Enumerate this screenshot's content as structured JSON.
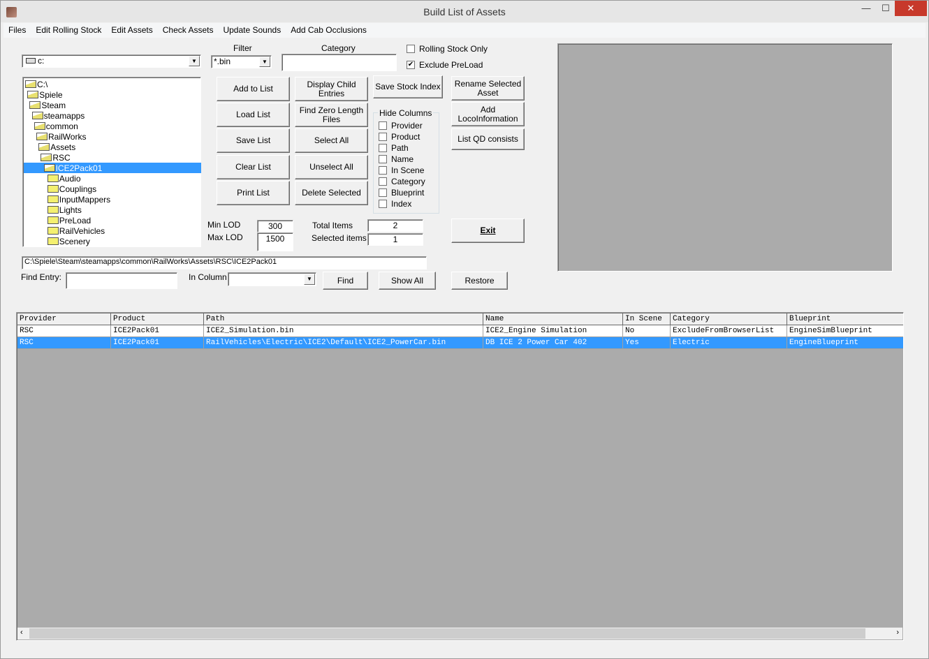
{
  "window": {
    "title": "Build List of Assets",
    "minimize": "—",
    "maximize": "☐",
    "close": "✕"
  },
  "menu": [
    "Files",
    "Edit Rolling Stock",
    "Edit Assets",
    "Check Assets",
    "Update Sounds",
    "Add Cab Occlusions"
  ],
  "drive": {
    "value": "c:"
  },
  "filter": {
    "label": "Filter",
    "value": "*.bin"
  },
  "category": {
    "label": "Category",
    "value": ""
  },
  "options": {
    "rolling_stock_only": {
      "label": "Rolling Stock Only",
      "checked": false
    },
    "exclude_preload": {
      "label": "Exclude PreLoad",
      "checked": true
    }
  },
  "tree": [
    {
      "label": "C:\\",
      "depth": 0,
      "open": true
    },
    {
      "label": "Spiele",
      "depth": 1,
      "open": true
    },
    {
      "label": "Steam",
      "depth": 2,
      "open": true
    },
    {
      "label": "steamapps",
      "depth": 3,
      "open": true
    },
    {
      "label": "common",
      "depth": 4,
      "open": true
    },
    {
      "label": "RailWorks",
      "depth": 5,
      "open": true
    },
    {
      "label": "Assets",
      "depth": 6,
      "open": true
    },
    {
      "label": "RSC",
      "depth": 7,
      "open": true
    },
    {
      "label": "ICE2Pack01",
      "depth": 8,
      "open": true,
      "selected": true
    },
    {
      "label": "Audio",
      "depth": 9
    },
    {
      "label": "Couplings",
      "depth": 9
    },
    {
      "label": "InputMappers",
      "depth": 9
    },
    {
      "label": "Lights",
      "depth": 9
    },
    {
      "label": "PreLoad",
      "depth": 9
    },
    {
      "label": "RailVehicles",
      "depth": 9
    },
    {
      "label": "Scenery",
      "depth": 9
    }
  ],
  "buttons": {
    "add_to_list": "Add to List",
    "load_list": "Load List",
    "save_list": "Save List",
    "clear_list": "Clear List",
    "print_list": "Print List",
    "display_child": "Display Child Entries",
    "find_zero": "Find Zero Length Files",
    "select_all": "Select All",
    "unselect_all": "Unselect All",
    "delete_selected": "Delete Selected",
    "save_stock_index": "Save Stock Index",
    "rename_selected": "Rename Selected Asset",
    "add_loco": "Add LocoInformation",
    "list_qd": "List QD consists",
    "exit": "Exit",
    "find": "Find",
    "show_all": "Show All",
    "restore": "Restore"
  },
  "hide_columns": {
    "label": "Hide Columns",
    "items": [
      "Provider",
      "Product",
      "Path",
      "Name",
      "In Scene",
      "Category",
      "Blueprint",
      "Index"
    ]
  },
  "lod": {
    "min_label": "Min LOD",
    "min": "300",
    "max_label": "Max LOD",
    "max": "1500"
  },
  "counts": {
    "total_label": "Total Items",
    "total": "2",
    "selected_label": "Selected items",
    "selected": "1"
  },
  "path": "C:\\Spiele\\Steam\\steamapps\\common\\RailWorks\\Assets\\RSC\\ICE2Pack01",
  "find": {
    "label": "Find Entry:",
    "value": "",
    "column_label": "In Column",
    "column_value": ""
  },
  "table": {
    "columns": [
      "Provider",
      "Product",
      "Path",
      "Name",
      "In Scene",
      "Category",
      "Blueprint"
    ],
    "rows": [
      [
        "RSC",
        "ICE2Pack01",
        "ICE2_Simulation.bin",
        "ICE2_Engine Simulation",
        "No",
        "ExcludeFromBrowserList",
        "EngineSimBlueprint"
      ],
      [
        "RSC",
        "ICE2Pack01",
        "RailVehicles\\Electric\\ICE2\\Default\\ICE2_PowerCar.bin",
        "DB ICE 2 Power Car 402",
        "Yes",
        "Electric",
        "EngineBlueprint"
      ]
    ],
    "selected_row": 1
  },
  "colors": {
    "selection": "#3399ff",
    "close": "#c7392b",
    "panel": "#ababab"
  }
}
